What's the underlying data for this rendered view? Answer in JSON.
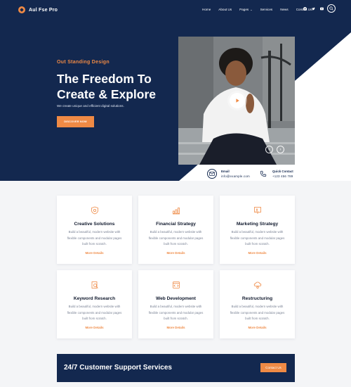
{
  "header": {
    "brand": "Aul Fse Pro",
    "nav": [
      {
        "label": "Home"
      },
      {
        "label": "About Us"
      },
      {
        "label": "Pages"
      },
      {
        "label": "Services"
      },
      {
        "label": "News"
      },
      {
        "label": "Contact Us"
      }
    ],
    "pages_has_dropdown": true,
    "social_icons": [
      "facebook-icon",
      "twitter-icon",
      "youtube-icon"
    ],
    "search_icon": "search-icon"
  },
  "hero": {
    "eyebrow": "Out Standing Design",
    "title": "The Freedom To Create & Explore",
    "subtitle": "We create unique and efficient digital solutions.",
    "cta_label": "DISCOVER NOW",
    "contacts": [
      {
        "label": "Email",
        "value": "info@example.com",
        "icon": "mail-icon"
      },
      {
        "label": "Quick Contact",
        "value": "+123 456 789",
        "icon": "phone-icon"
      }
    ]
  },
  "services": [
    {
      "title": "Creative Solutions",
      "text": "Build a beautiful, modern website with flexible components and modular pages built from scratch.",
      "link": "More Details",
      "icon": "shield-icon"
    },
    {
      "title": "Financial Strategy",
      "text": "Build a beautiful, modern website with flexible components and modular pages built from scratch.",
      "link": "More Details",
      "icon": "bar-chart-icon"
    },
    {
      "title": "Marketing Strategy",
      "text": "Build a beautiful, modern website with flexible components and modular pages built from scratch.",
      "link": "More Details",
      "icon": "presentation-icon"
    },
    {
      "title": "Keyword Research",
      "text": "Build a beautiful, modern website with flexible components and modular pages built from scratch.",
      "link": "More Details",
      "icon": "search-doc-icon"
    },
    {
      "title": "Web Development",
      "text": "Build a beautiful, modern website with flexible components and modular pages built from scratch.",
      "link": "More Details",
      "icon": "browser-code-icon"
    },
    {
      "title": "Restructuring",
      "text": "Build a beautiful, modern website with flexible components and modular pages built from scratch.",
      "link": "More Details",
      "icon": "cloud-settings-icon"
    }
  ],
  "support": {
    "title": "24/7 Customer Support Services",
    "button_label": "Contact Us"
  },
  "colors": {
    "navy": "#13284f",
    "accent": "#ef8a45",
    "light_bg": "#f4f5f7"
  }
}
